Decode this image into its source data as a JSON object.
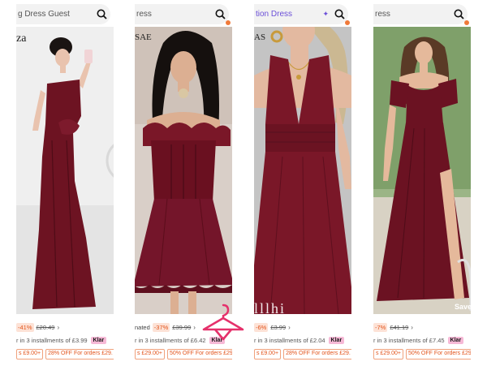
{
  "panels": [
    {
      "search_text": "g Dress Guest",
      "search_text_purple": false,
      "brand_mark": "za",
      "price_label": "",
      "discount": "-41%",
      "old_price": "£20.49",
      "installments": "r in 3 installments of £3.99",
      "klarna": "Klar",
      "promo_left": "s £9.00+",
      "promo_right": "28% OFF For orders £29.",
      "dress_color": "#6d1322",
      "bg_color": "#efefef"
    },
    {
      "search_text": "ress",
      "search_text_purple": false,
      "brand_mark": "SAE",
      "price_label": "nated",
      "discount": "-37%",
      "old_price": "£39.99",
      "installments": "r in 3 installments of £6.42",
      "klarna": "Klar",
      "promo_left": "s £29.00+",
      "promo_right": "50% OFF For orders £29.",
      "dress_color": "#6a1020",
      "bg_color": "#d9cfc8"
    },
    {
      "search_text": "tion Dress",
      "search_text_purple": true,
      "brand_mark": "AS",
      "price_label": "",
      "discount": "-6%",
      "old_price": "£3.99",
      "installments": "r in 3 installments of £2.04",
      "klarna": "Klar",
      "promo_left": "s £9.00+",
      "promo_right": "28% OFF For orders £29.",
      "dress_color": "#7a1728",
      "bg_color": "#c9c9c9",
      "overlay_text": "lllhi"
    },
    {
      "search_text": "ress",
      "search_text_purple": false,
      "brand_mark": "",
      "price_label": "",
      "discount": "-7%",
      "old_price": "£41.19",
      "installments": "r in 3 installments of £7.45",
      "klarna": "Klar",
      "promo_left": "s £29.00+",
      "promo_right": "50% OFF For orders £29.",
      "dress_color": "#6b1222",
      "bg_color": "#9bb586",
      "save_text": "Save"
    }
  ]
}
